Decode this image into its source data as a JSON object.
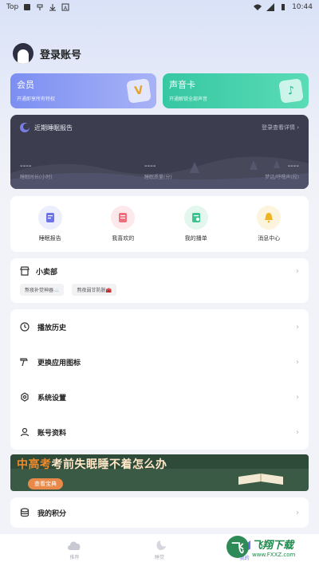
{
  "status_bar": {
    "app_label": "Top",
    "time": "10:44"
  },
  "profile": {
    "name": "登录账号"
  },
  "cards": [
    {
      "title": "会员",
      "subtitle": "开通即享所有特权",
      "badge": "V"
    },
    {
      "title": "声音卡",
      "subtitle": "开通解锁全部声音",
      "badge": "♪"
    }
  ],
  "sleep_report": {
    "title": "近期睡眠报告",
    "login_link": "登录查看详情",
    "metrics": [
      {
        "value": "----",
        "label": "睡眠时长(小时)"
      },
      {
        "value": "----",
        "label": "睡眠质量(分)"
      },
      {
        "value": "----",
        "label": "梦话/呼噜声(段)"
      }
    ]
  },
  "quick_actions": [
    {
      "label": "睡眠报告",
      "icon": "report-icon",
      "color": "#6c73e6",
      "bg": "#eceefd"
    },
    {
      "label": "我喜欢的",
      "icon": "favorite-icon",
      "color": "#ef6d7c",
      "bg": "#fde9ec"
    },
    {
      "label": "我的播单",
      "icon": "playlist-icon",
      "color": "#3bc48f",
      "bg": "#e3f7ee"
    },
    {
      "label": "消息中心",
      "icon": "bell-icon",
      "color": "#f0b422",
      "bg": "#fdf4dd"
    }
  ],
  "shop": {
    "title": "小卖部",
    "tags": [
      "熬夜补觉神器☁️",
      "熬夜弱甘防脱🧰"
    ]
  },
  "menu": [
    {
      "label": "播放历史",
      "icon": "clock-icon"
    },
    {
      "label": "更换应用图标",
      "icon": "hammer-icon"
    },
    {
      "label": "系统设置",
      "icon": "gear-icon"
    },
    {
      "label": "账号资料",
      "icon": "user-icon"
    }
  ],
  "banner": {
    "headline_a": "中高考",
    "headline_b": "考前失眠睡不着怎么办",
    "button": "查看宝典"
  },
  "points": {
    "label": "我的积分"
  },
  "tabs": [
    {
      "label": "推荐",
      "icon": "cloud-icon",
      "active": false
    },
    {
      "label": "睡觉",
      "icon": "moon-icon",
      "active": false
    },
    {
      "label": "我的",
      "icon": "cat-icon",
      "active": true
    }
  ],
  "watermark": {
    "logo": "飞",
    "name": "飞翔下载",
    "url": "www.FXXZ.com"
  },
  "colors": {
    "accent": "#6e72e6",
    "report_bg": "#3c3d4e"
  }
}
